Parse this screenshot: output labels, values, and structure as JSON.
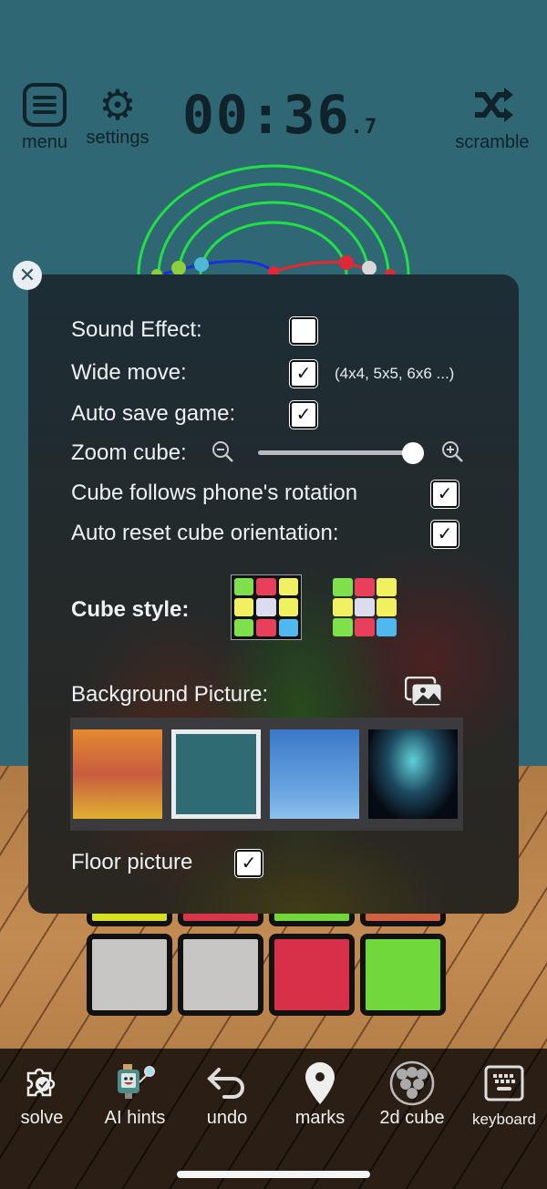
{
  "top_bar": {
    "menu_label": "menu",
    "settings_label": "settings",
    "timer_main": "00:36",
    "timer_fraction": ".7",
    "scramble_label": "scramble"
  },
  "settings_panel": {
    "close_label": "✕",
    "sound_effect": {
      "label": "Sound Effect:",
      "checked": false
    },
    "wide_move": {
      "label": "Wide move:",
      "checked": true,
      "note": "(4x4, 5x5, 6x6 ...)"
    },
    "auto_save": {
      "label": "Auto save game:",
      "checked": true
    },
    "zoom_cube": {
      "label": "Zoom cube:",
      "value_percent": 100
    },
    "follow_rotation": {
      "label": "Cube follows phone's rotation",
      "checked": true
    },
    "auto_reset": {
      "label": "Auto reset cube orientation:",
      "checked": true
    },
    "cube_style": {
      "label": "Cube style:",
      "options": [
        {
          "name": "classic-black",
          "selected": true,
          "colors": [
            "#7ee04a",
            "#e8405a",
            "#f0f060",
            "#f0f060",
            "#dcdcf0",
            "#f0f060",
            "#7ee04a",
            "#e8405a",
            "#50b8f0"
          ]
        },
        {
          "name": "stickerless",
          "selected": false,
          "colors": [
            "#7ee04a",
            "#e8405a",
            "#f0f060",
            "#f0f060",
            "#dcdcf0",
            "#f0f060",
            "#7ee04a",
            "#e8405a",
            "#50b8f0"
          ]
        }
      ]
    },
    "background_picture": {
      "label": "Background Picture:",
      "thumbnails": [
        {
          "name": "sunset-gradient",
          "selected": false
        },
        {
          "name": "teal-solid",
          "selected": true
        },
        {
          "name": "blue-sky",
          "selected": false
        },
        {
          "name": "night-sky",
          "selected": false
        }
      ]
    },
    "floor_picture": {
      "label": "Floor picture",
      "checked": true
    },
    "check_glyph": "✓"
  },
  "toolbar": {
    "items": [
      {
        "label": "solve"
      },
      {
        "label": "AI hints"
      },
      {
        "label": "undo"
      },
      {
        "label": "marks"
      },
      {
        "label": "2d cube"
      },
      {
        "label": "keyboard"
      }
    ]
  }
}
